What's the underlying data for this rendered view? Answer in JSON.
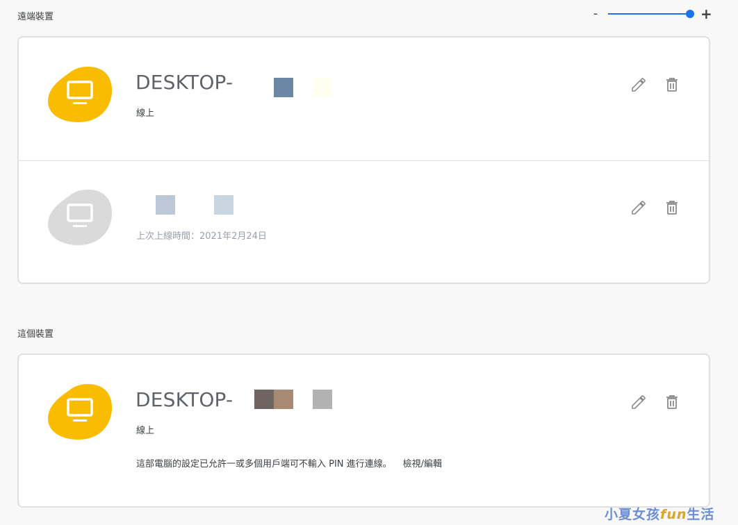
{
  "sections": {
    "remote_label": "遠端裝置",
    "this_label": "這個裝置"
  },
  "zoom": {
    "minus": "-",
    "plus": "+",
    "level_fraction": 0.98
  },
  "remote_devices": [
    {
      "name": "DESKTOP-",
      "status": "線上",
      "online": true
    },
    {
      "name": "",
      "status": "上次上線時間：2021年2月24日",
      "online": false
    }
  ],
  "this_device": {
    "name": "DESKTOP-",
    "status": "線上",
    "pin_note": "這部電腦的設定已允許一或多個用戶端可不輸入 PIN 進行連線。",
    "pin_link": "檢視/編輯"
  },
  "colors": {
    "online": "#f9bc00",
    "offline": "#dadada",
    "accent": "#1a73e8"
  },
  "icons": {
    "device": "monitor-icon",
    "edit": "pencil-icon",
    "delete": "trash-icon"
  },
  "watermark": {
    "text_a": "小",
    "text_b": "夏",
    "text_c": "女孩",
    "text_fun": "fun",
    "text_d": "生",
    "text_e": "活"
  }
}
